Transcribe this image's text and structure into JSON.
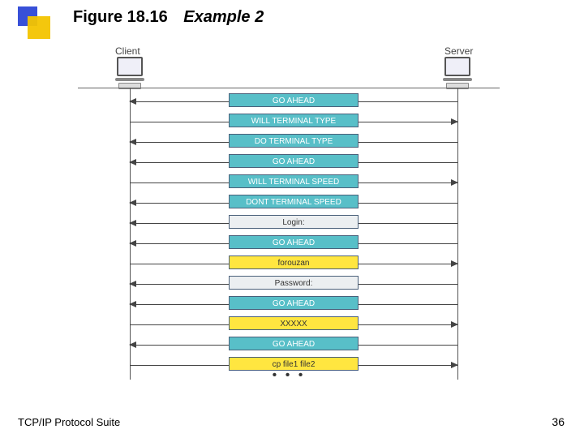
{
  "title": {
    "figure": "Figure 18.16",
    "example": "Example 2"
  },
  "footer": {
    "left": "TCP/IP Protocol Suite",
    "page": "36"
  },
  "endpoints": {
    "client": "Client",
    "server": "Server"
  },
  "ellipsis": "• • •",
  "messages": [
    {
      "dir": "left",
      "color": "teal",
      "text": "GO AHEAD"
    },
    {
      "dir": "right",
      "color": "teal",
      "text": "WILL TERMINAL TYPE"
    },
    {
      "dir": "left",
      "color": "teal",
      "text": "DO TERMINAL TYPE"
    },
    {
      "dir": "left",
      "color": "teal",
      "text": "GO AHEAD"
    },
    {
      "dir": "right",
      "color": "teal",
      "text": "WILL TERMINAL SPEED"
    },
    {
      "dir": "left",
      "color": "teal",
      "text": "DONT TERMINAL SPEED"
    },
    {
      "dir": "left",
      "color": "gray",
      "text": "Login:"
    },
    {
      "dir": "left",
      "color": "teal",
      "text": "GO AHEAD"
    },
    {
      "dir": "right",
      "color": "yellow",
      "text": "forouzan"
    },
    {
      "dir": "left",
      "color": "gray",
      "text": "Password:"
    },
    {
      "dir": "left",
      "color": "teal",
      "text": "GO AHEAD"
    },
    {
      "dir": "right",
      "color": "yellow",
      "text": "XXXXX"
    },
    {
      "dir": "left",
      "color": "teal",
      "text": "GO AHEAD"
    },
    {
      "dir": "right",
      "color": "yellow",
      "text": "cp file1 file2"
    }
  ]
}
